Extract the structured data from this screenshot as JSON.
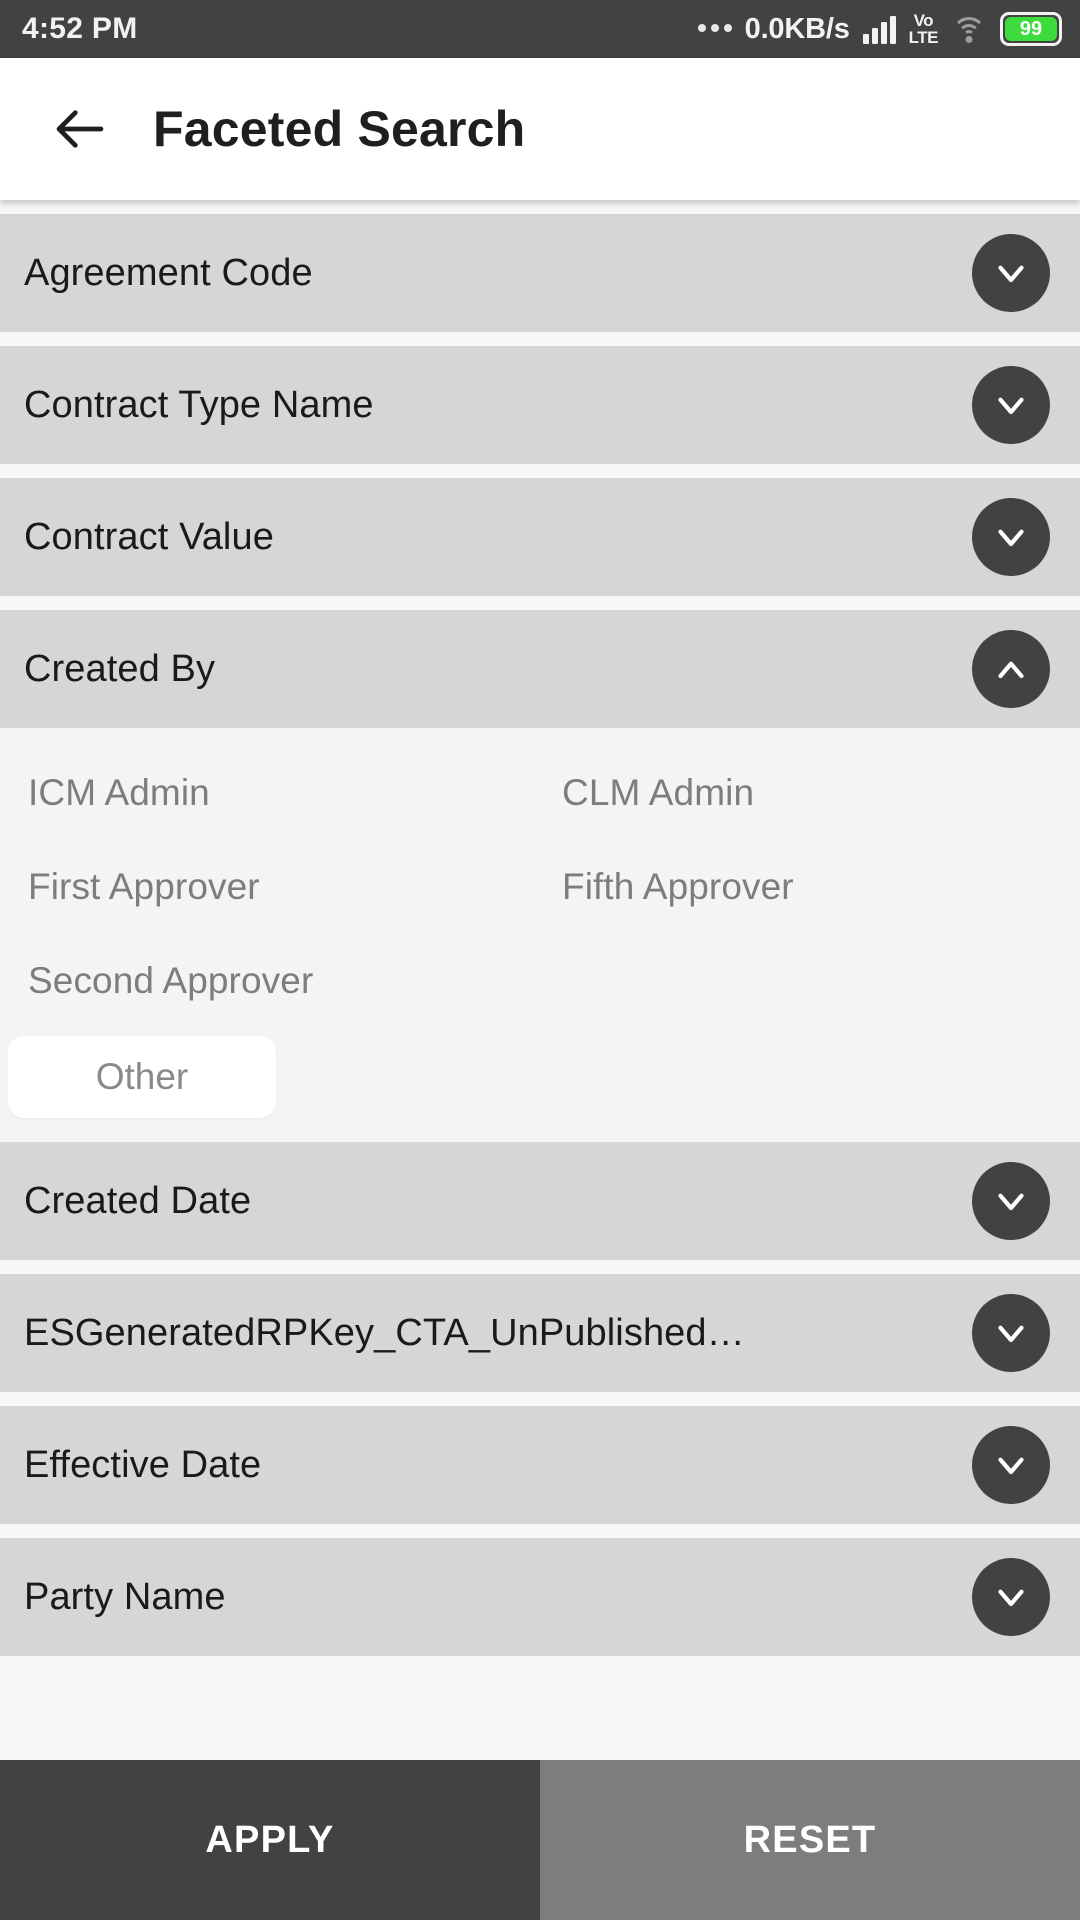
{
  "status_bar": {
    "time": "4:52 PM",
    "overflow_dots": "•••",
    "network_speed": "0.0KB/s",
    "volte_top": "Vo",
    "volte_bottom": "LTE",
    "battery_level": "99",
    "battery_color": "#3ddc3d",
    "background": "#424242"
  },
  "header": {
    "back_label": "back-arrow",
    "title": "Faceted Search"
  },
  "facets": [
    {
      "label": "Agreement Code",
      "expanded": false,
      "chevron": "chevron-down"
    },
    {
      "label": "Contract Type Name",
      "expanded": false,
      "chevron": "chevron-down"
    },
    {
      "label": "Contract Value",
      "expanded": false,
      "chevron": "chevron-down"
    },
    {
      "label": "Created By",
      "expanded": true,
      "chevron": "chevron-up"
    },
    {
      "label": "Created Date",
      "expanded": false,
      "chevron": "chevron-down"
    },
    {
      "label": "ESGeneratedRPKey_CTA_UnPublished_ICMFre…",
      "expanded": false,
      "chevron": "chevron-down"
    },
    {
      "label": "Effective Date",
      "expanded": false,
      "chevron": "chevron-down"
    },
    {
      "label": "Party Name",
      "expanded": false,
      "chevron": "chevron-down"
    }
  ],
  "created_by_options": {
    "left": [
      "ICM Admin",
      "First Approver",
      "Second Approver"
    ],
    "right": [
      "CLM Admin",
      "Fifth Approver"
    ],
    "chip": "Other"
  },
  "footer": {
    "apply_label": "APPLY",
    "reset_label": "RESET",
    "apply_color": "#424242",
    "reset_color": "#7d7d7d"
  }
}
